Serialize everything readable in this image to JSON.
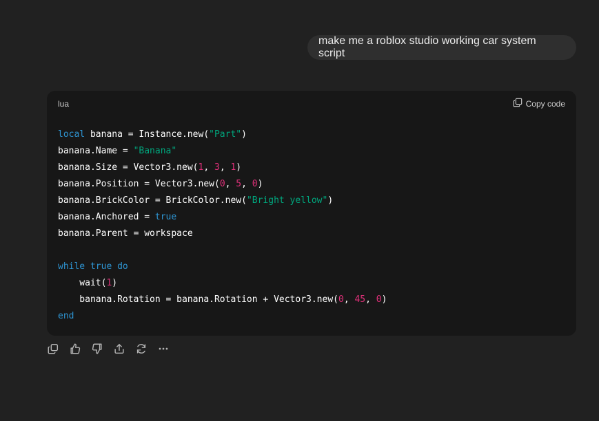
{
  "user_message": "make me a roblox studio working car system script",
  "code_block": {
    "language": "lua",
    "copy_label": "Copy code",
    "lines": [
      [
        {
          "t": "local",
          "c": "kw"
        },
        {
          "t": " banana = Instance.new(",
          "c": ""
        },
        {
          "t": "\"Part\"",
          "c": "str"
        },
        {
          "t": ")",
          "c": ""
        }
      ],
      [
        {
          "t": "banana.Name = ",
          "c": ""
        },
        {
          "t": "\"Banana\"",
          "c": "str"
        }
      ],
      [
        {
          "t": "banana.Size = Vector3.new(",
          "c": ""
        },
        {
          "t": "1",
          "c": "num"
        },
        {
          "t": ", ",
          "c": ""
        },
        {
          "t": "3",
          "c": "num"
        },
        {
          "t": ", ",
          "c": ""
        },
        {
          "t": "1",
          "c": "num"
        },
        {
          "t": ")",
          "c": ""
        }
      ],
      [
        {
          "t": "banana.Position = Vector3.new(",
          "c": ""
        },
        {
          "t": "0",
          "c": "num"
        },
        {
          "t": ", ",
          "c": ""
        },
        {
          "t": "5",
          "c": "num"
        },
        {
          "t": ", ",
          "c": ""
        },
        {
          "t": "0",
          "c": "num"
        },
        {
          "t": ")",
          "c": ""
        }
      ],
      [
        {
          "t": "banana.BrickColor = BrickColor.new(",
          "c": ""
        },
        {
          "t": "\"Bright yellow\"",
          "c": "str"
        },
        {
          "t": ")",
          "c": ""
        }
      ],
      [
        {
          "t": "banana.Anchored = ",
          "c": ""
        },
        {
          "t": "true",
          "c": "kw"
        }
      ],
      [
        {
          "t": "banana.Parent = workspace",
          "c": ""
        }
      ],
      [],
      [
        {
          "t": "while",
          "c": "kw"
        },
        {
          "t": " ",
          "c": ""
        },
        {
          "t": "true",
          "c": "kw"
        },
        {
          "t": " ",
          "c": ""
        },
        {
          "t": "do",
          "c": "kw"
        }
      ],
      [
        {
          "t": "    wait(",
          "c": ""
        },
        {
          "t": "1",
          "c": "num"
        },
        {
          "t": ")",
          "c": ""
        }
      ],
      [
        {
          "t": "    banana.Rotation = banana.Rotation + Vector3.new(",
          "c": ""
        },
        {
          "t": "0",
          "c": "num"
        },
        {
          "t": ", ",
          "c": ""
        },
        {
          "t": "45",
          "c": "num"
        },
        {
          "t": ", ",
          "c": ""
        },
        {
          "t": "0",
          "c": "num"
        },
        {
          "t": ")",
          "c": ""
        }
      ],
      [
        {
          "t": "end",
          "c": "kw"
        }
      ]
    ]
  },
  "actions": [
    {
      "name": "copy-response-button",
      "icon": "copy-icon"
    },
    {
      "name": "thumbs-up-button",
      "icon": "thumbs-up-icon"
    },
    {
      "name": "thumbs-down-button",
      "icon": "thumbs-down-icon"
    },
    {
      "name": "share-button",
      "icon": "share-icon"
    },
    {
      "name": "regenerate-button",
      "icon": "refresh-icon"
    },
    {
      "name": "more-options-button",
      "icon": "ellipsis-icon"
    }
  ],
  "colors": {
    "keyword": "#2e95d3",
    "string": "#00a67d",
    "number": "#df3079",
    "background": "#212121",
    "code_background": "#171717"
  }
}
